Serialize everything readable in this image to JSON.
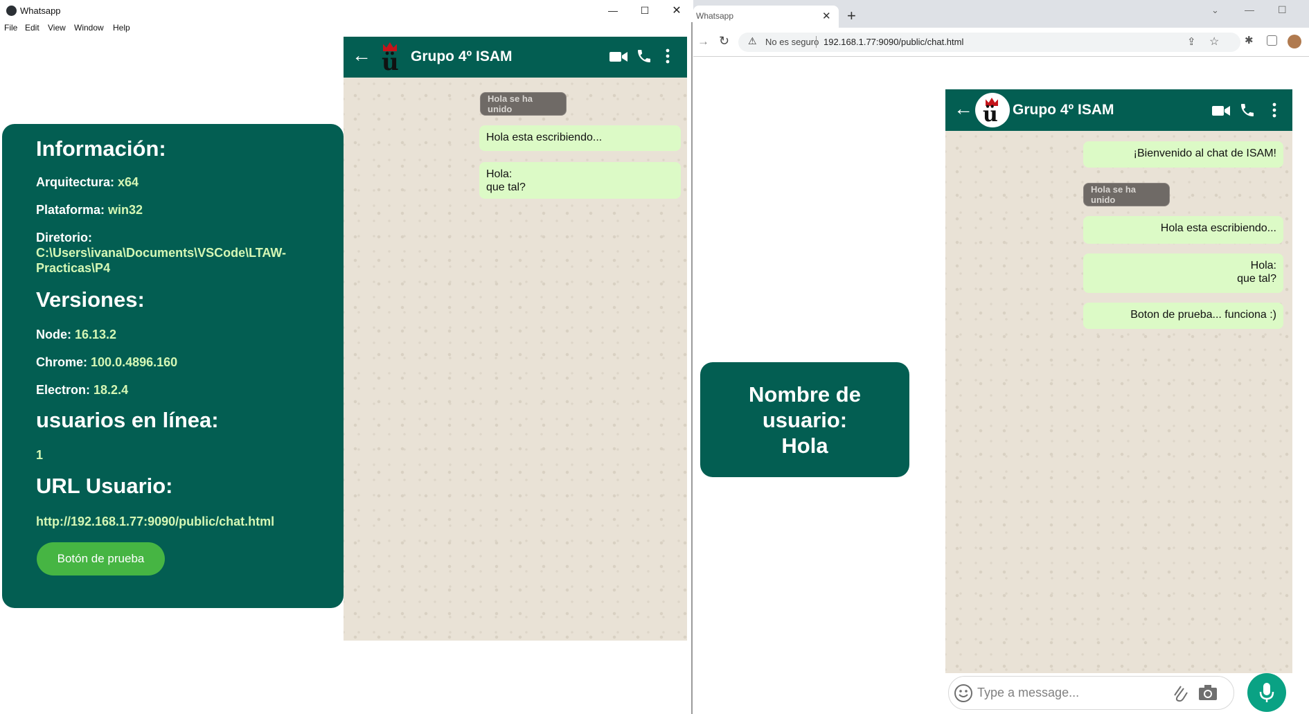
{
  "electron": {
    "title": "Whatsapp",
    "menu": [
      "File",
      "Edit",
      "View",
      "Window",
      "Help"
    ],
    "window_controls": {
      "minimize": "—",
      "maximize": "☐",
      "close": "✕"
    },
    "info": {
      "info_heading": "Información:",
      "arch_label": "Arquitectura:",
      "arch_value": "x64",
      "platform_label": "Plataforma:",
      "platform_value": "win32",
      "dir_label": "Diretorio:",
      "dir_value_1": "C:\\Users\\ivana\\Documents\\VSCode\\LTAW-",
      "dir_value_2": "Practicas\\P4",
      "versions_heading": "Versiones:",
      "node_label": "Node:",
      "node_value": "16.13.2",
      "chrome_label": "Chrome:",
      "chrome_value": "100.0.4896.160",
      "electron_label": "Electron:",
      "electron_value": "18.2.4",
      "users_heading": "usuarios en línea:",
      "users_value": "1",
      "url_heading": "URL Usuario:",
      "url_value": "http://192.168.1.77:9090/public/chat.html",
      "button_label": "Botón de prueba"
    },
    "chat": {
      "group_name": "Grupo 4º ISAM",
      "system_msg": "Hola se ha unido",
      "messages": [
        "Hola esta escribiendo...",
        "Hola:",
        "que tal?"
      ]
    }
  },
  "chrome": {
    "tab_title": "Whatsapp",
    "security_label": "No es seguro",
    "url": "192.168.1.77:9090/public/chat.html",
    "chat": {
      "group_name": "Grupo 4º ISAM",
      "messages": [
        "¡Bienvenido al chat de ISAM!",
        "Hola esta escribiendo...",
        "Hola:",
        "que tal?",
        "Boton de prueba... funciona :)"
      ],
      "system_msg": "Hola se ha unido",
      "input_placeholder": "Type a message..."
    },
    "username_panel": {
      "line1": "Nombre de",
      "line2": "usuario:",
      "line3": "Hola"
    }
  },
  "colors": {
    "header_green": "#035e52",
    "bubble_green": "#dcfac6",
    "button_green": "#46b543",
    "mic_green": "#0aa284",
    "value_text": "#d5f7b5"
  }
}
